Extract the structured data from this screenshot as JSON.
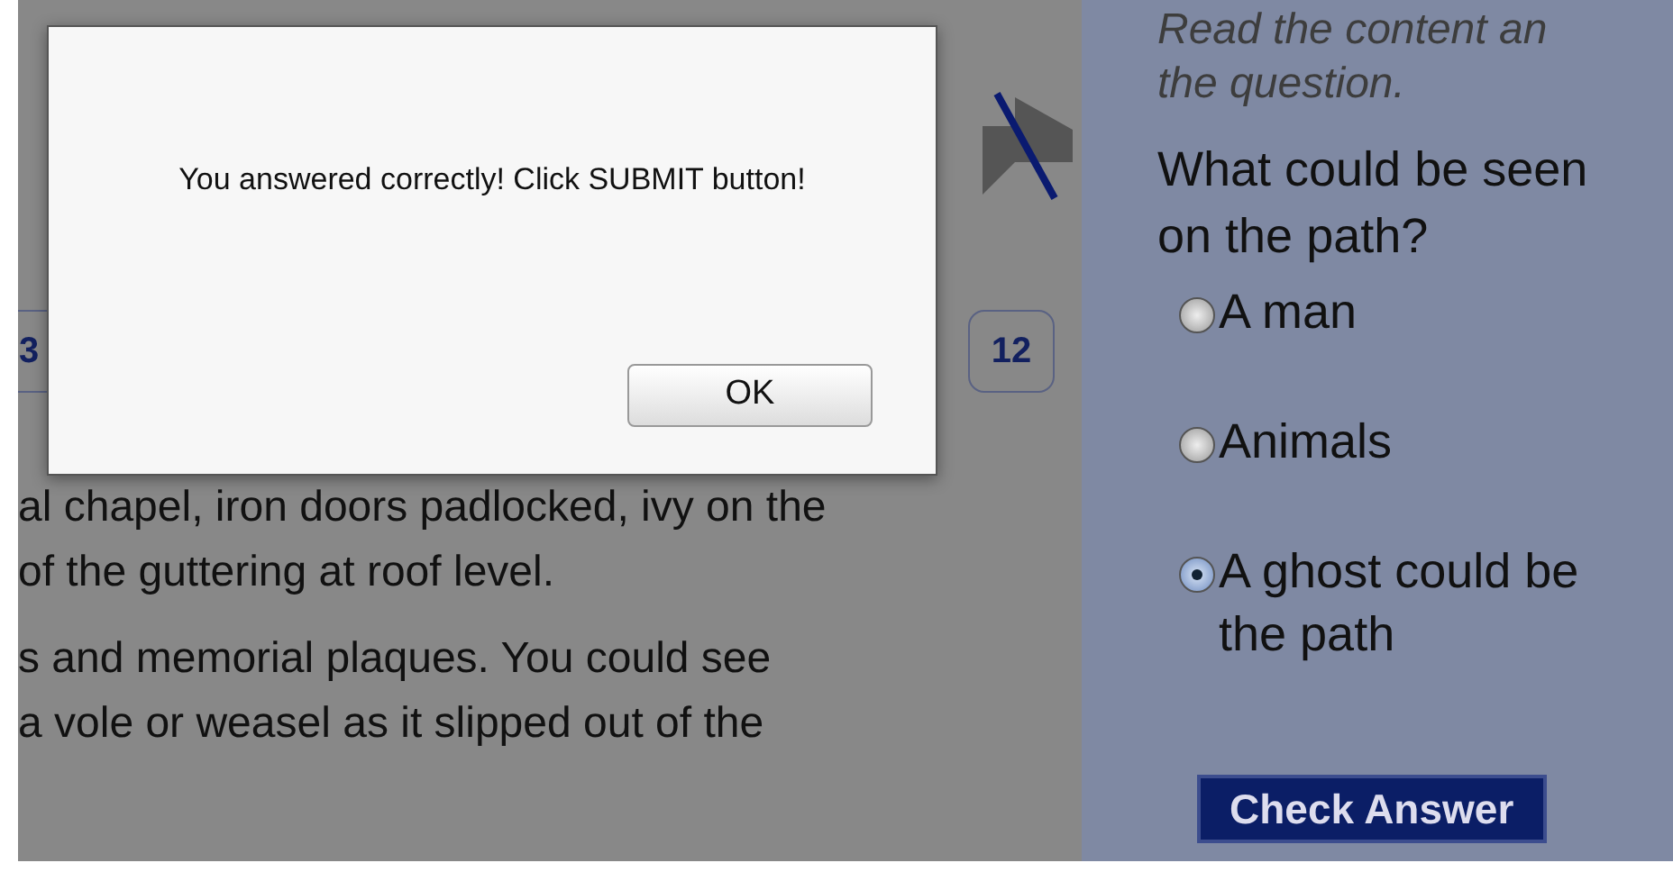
{
  "pages": [
    {
      "label": "3",
      "selected": false
    },
    {
      "label": "12",
      "selected": false
    }
  ],
  "passage": [
    {
      "lines": [
        "al chapel, iron doors padlocked, ivy on the",
        "of the guttering at roof level."
      ]
    },
    {
      "lines": [
        "s and memorial plaques. You could see",
        "a vole or weasel as it slipped out of the"
      ]
    }
  ],
  "panel": {
    "instructions": [
      "Read the content an",
      "the question."
    ],
    "question": [
      "What could be seen",
      "on the path?"
    ],
    "options": [
      {
        "lines": [
          "A man"
        ],
        "selected": false
      },
      {
        "lines": [
          "Animals"
        ],
        "selected": false
      },
      {
        "lines": [
          "A ghost could be",
          "the path"
        ],
        "selected": true
      }
    ],
    "button": "Check Answer"
  },
  "dialog": {
    "message": "You answered correctly! Click SUBMIT button!",
    "button": "OK"
  }
}
